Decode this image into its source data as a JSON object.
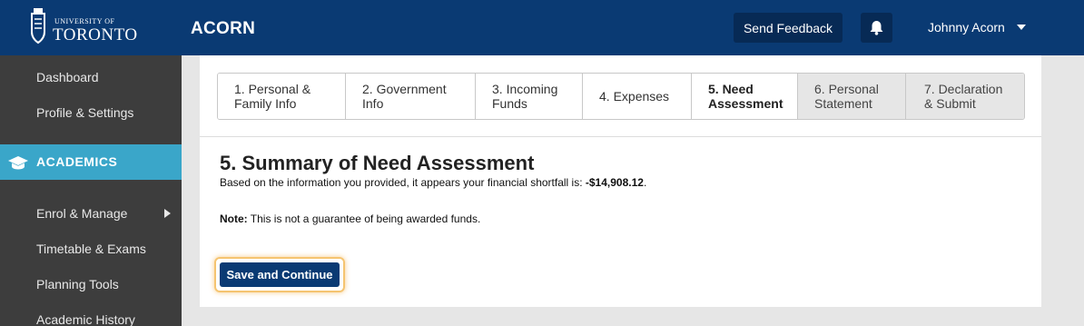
{
  "header": {
    "logo_small": "UNIVERSITY OF",
    "logo_big": "TORONTO",
    "app_title": "ACORN",
    "feedback_label": "Send Feedback",
    "user_name": "Johnny Acorn",
    "bar_color": "#0a3a73"
  },
  "sidebar": {
    "items": [
      {
        "label": "Dashboard"
      },
      {
        "label": "Profile & Settings"
      },
      {
        "label": "ACADEMICS",
        "section": true,
        "icon": "graduation-cap-icon"
      },
      {
        "label": "Enrol & Manage",
        "has_submenu": true
      },
      {
        "label": "Timetable & Exams"
      },
      {
        "label": "Planning Tools"
      },
      {
        "label": "Academic History"
      }
    ],
    "accent_color": "#3aa6c9"
  },
  "steps": [
    {
      "label_1": "1. Personal &",
      "label_2": "Family Info",
      "state": "normal"
    },
    {
      "label_1": "2. Government",
      "label_2": "Info",
      "state": "normal"
    },
    {
      "label_1": "3. Incoming",
      "label_2": "Funds",
      "state": "normal"
    },
    {
      "label_1": "4. Expenses",
      "label_2": "",
      "state": "normal"
    },
    {
      "label_1": "5. Need",
      "label_2": "Assessment",
      "state": "active"
    },
    {
      "label_1": "6. Personal",
      "label_2": "Statement",
      "state": "disabled"
    },
    {
      "label_1": "7. Declaration",
      "label_2": "& Submit",
      "state": "disabled"
    }
  ],
  "content": {
    "title": "5. Summary of Need Assessment",
    "summary_prefix": "Based on the information you provided, it appears your financial shortfall is: ",
    "shortfall": "-$14,908.12",
    "summary_suffix": ".",
    "note_label": "Note:",
    "note_text": " This is not a guarantee of being awarded funds.",
    "save_label": "Save and Continue"
  }
}
